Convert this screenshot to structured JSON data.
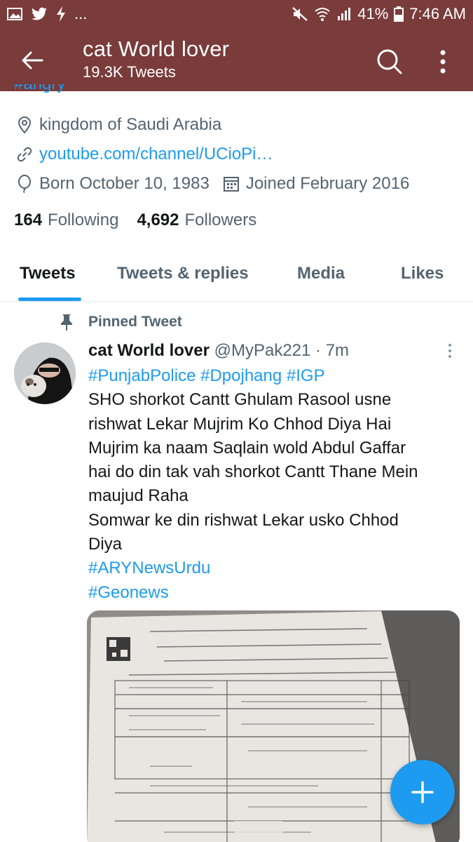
{
  "status_bar": {
    "battery": "41%",
    "time": "7:46 AM",
    "ellipsis": "..."
  },
  "header": {
    "title": "cat World lover",
    "subtitle": "19.3K Tweets"
  },
  "profile": {
    "cut_hashtag": "#angry",
    "location": "kingdom of Saudi Arabia",
    "link": "youtube.com/channel/UCioPi…",
    "born": "Born October 10, 1983",
    "joined": "Joined February 2016",
    "following_count": "164",
    "following_label": "Following",
    "followers_count": "4,692",
    "followers_label": "Followers"
  },
  "tabs": [
    {
      "label": "Tweets"
    },
    {
      "label": "Tweets & replies"
    },
    {
      "label": "Media"
    },
    {
      "label": "Likes"
    }
  ],
  "pinned_label": "Pinned Tweet",
  "tweet": {
    "name": "cat World lover",
    "handle": "@MyPak221",
    "sep": " · ",
    "time": "7m",
    "hashtags_line": "#PunjabPolice #Dpojhang #IGP",
    "lines": [
      "SHO shorkot Cantt Ghulam Rasool usne",
      "rishwat Lekar Mujrim Ko Chhod Diya Hai",
      "Mujrim ka naam Saqlain wold  Abdul Gaffar",
      "hai do din tak vah shorkot Cantt Thane Mein",
      "maujud Raha",
      "Somwar ke din rishwat Lekar usko Chhod",
      "Diya"
    ],
    "tag_ary": "#ARYNewsUrdu",
    "tag_geo": "#Geonews"
  },
  "colors": {
    "header_bg": "#7a3b3b",
    "accent": "#1d9bf0",
    "muted": "#536471"
  }
}
